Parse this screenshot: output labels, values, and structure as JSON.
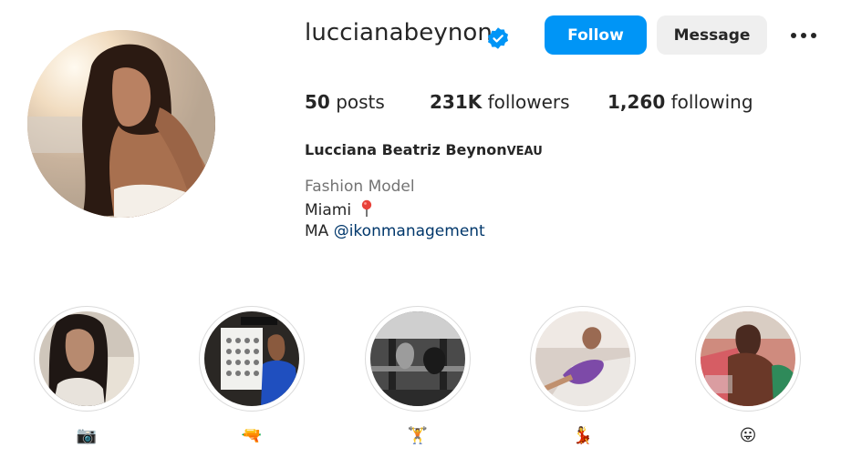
{
  "profile": {
    "username": "luccianabeynon",
    "verified": true,
    "follow_label": "Follow",
    "message_label": "Message",
    "more_icon": "more-options-icon",
    "stats": {
      "posts_count": "50",
      "posts_label": "posts",
      "followers_count": "231K",
      "followers_label": "followers",
      "following_count": "1,260",
      "following_label": "following"
    },
    "full_name": "Lucciana Beatriz Beynon",
    "full_name_suffix": "VEAU",
    "bio": {
      "category": "Fashion Model",
      "city": "Miami",
      "city_emoji": "pushpin",
      "mgmt_prefix": "MA",
      "mgmt_mention": "@ikonmanagement"
    }
  },
  "colors": {
    "accent": "#0095f6",
    "verified_badge": "#0095f6",
    "mention": "#00376b",
    "category": "#737373",
    "button_secondary": "#efefef"
  },
  "highlights": [
    {
      "label": "📷",
      "icon": "camera-emoji"
    },
    {
      "label": "🔫",
      "icon": "water-pistol-emoji"
    },
    {
      "label": "🏋",
      "icon": "weight-lifter-emoji"
    },
    {
      "label": "💃",
      "icon": "dancer-emoji"
    },
    {
      "label": "😛",
      "icon": "tongue-face-emoji"
    }
  ]
}
